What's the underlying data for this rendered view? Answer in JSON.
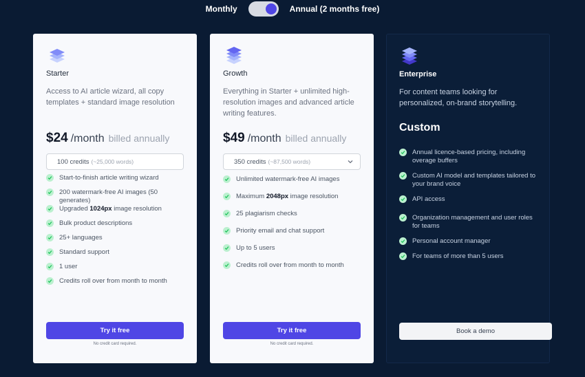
{
  "billing": {
    "monthly_label": "Monthly",
    "annual_label": "Annual (2 months free)",
    "selected": "annual"
  },
  "colors": {
    "background": "#0a1b33",
    "accent": "#4f46e5",
    "check": "#22c55e"
  },
  "plans": [
    {
      "icon": "stack-layers-icon",
      "name": "Starter",
      "description": "Access to AI article wizard, all copy templates + standard image resolution",
      "price": "$24",
      "period": "/month",
      "billed": "billed annually",
      "credits": "100 credits",
      "credits_sub": "(~25,000 words)",
      "features": [
        "Start-to-finish article writing wizard",
        "200 watermark-free AI images (50 generates)",
        "Upgraded 1024px image resolution",
        "Bulk product descriptions",
        "25+ languages",
        "Standard support",
        "1 user",
        "Credits roll over from month to month"
      ],
      "cta": "Try it free",
      "note": "No credit card required."
    },
    {
      "icon": "stack-layers-icon",
      "name": "Growth",
      "description": "Everything in Starter + unlimited high-resolution images and advanced article writing features.",
      "price": "$49",
      "period": "/month",
      "billed": "billed annually",
      "credits": "350 credits",
      "credits_sub": "(~87,500 words)",
      "features": [
        "Unlimited watermark-free AI images",
        "Maximum 2048px image resolution",
        "25 plagiarism checks",
        "Priority email and chat support",
        "Up to 5 users",
        "Credits roll over from month to month"
      ],
      "cta": "Try it free",
      "note": "No credit card required."
    },
    {
      "icon": "stack-layers-icon",
      "name": "Enterprise",
      "description": "For content teams looking for personalized, on-brand storytelling.",
      "price": "Custom",
      "features": [
        "Annual licence-based pricing, including overage buffers",
        "Custom AI model and templates tailored to your brand voice",
        "API access",
        "Organization management and user roles for teams",
        "Personal account manager",
        "For teams of more than 5 users"
      ],
      "cta": "Book a demo"
    }
  ]
}
